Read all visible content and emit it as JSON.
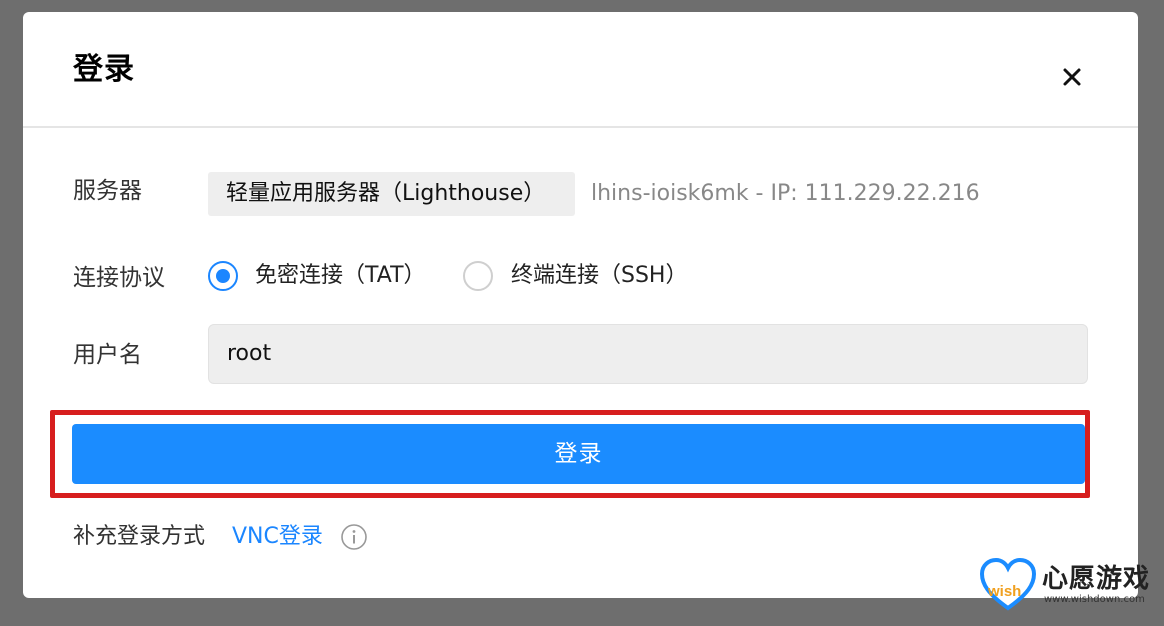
{
  "dialog": {
    "title": "登录",
    "close_icon": "close-icon"
  },
  "server": {
    "label": "服务器",
    "chip": "轻量应用服务器（Lighthouse）",
    "info": "lhins-ioisk6mk - IP: 111.229.22.216"
  },
  "protocol": {
    "label": "连接协议",
    "options": [
      {
        "label": "免密连接（TAT）",
        "selected": true
      },
      {
        "label": "终端连接（SSH）",
        "selected": false
      }
    ]
  },
  "username": {
    "label": "用户名",
    "value": "root"
  },
  "login_button": {
    "label": "登录",
    "highlight_color": "#d71e1e",
    "color": "#1b8cff"
  },
  "alternative": {
    "label": "补充登录方式",
    "link": "VNC登录",
    "info_icon": "info-icon"
  },
  "watermark": {
    "brand": "心愿游戏",
    "url": "www.wishdown.com",
    "logo_text": "wish"
  }
}
